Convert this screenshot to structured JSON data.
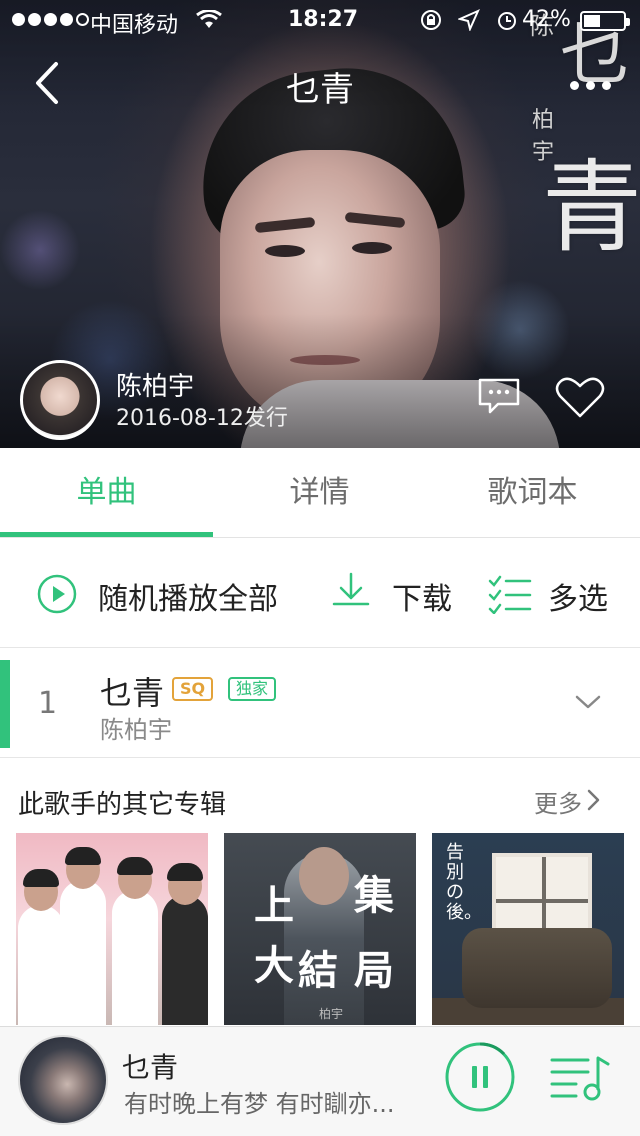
{
  "status_bar": {
    "carrier": "中国移动",
    "time": "18:27",
    "battery_percent": "42%",
    "battery_level": 0.42
  },
  "nav": {
    "title": "乜青"
  },
  "hero": {
    "artist_name": "陈柏宇",
    "release_date": "2016-08-12发行"
  },
  "tabs": [
    {
      "label": "单曲",
      "active": true
    },
    {
      "label": "详情",
      "active": false
    },
    {
      "label": "歌词本",
      "active": false
    }
  ],
  "actions": {
    "play_all": "随机播放全部",
    "download": "下载",
    "multi_select": "多选"
  },
  "tracks": [
    {
      "number": "1",
      "title": "乜青",
      "badges": [
        "SQ",
        "独家"
      ],
      "artist": "陈柏宇"
    }
  ],
  "other_albums": {
    "title": "此歌手的其它专辑",
    "more": "更多",
    "album2_text": [
      "上",
      "集",
      "大",
      "結",
      "局"
    ],
    "album2_sub": "柏宇",
    "album3_title": "告別の後。"
  },
  "player": {
    "title": "乜青",
    "lyric": "有时晚上有梦 有时瞓亦..."
  },
  "colors": {
    "accent": "#31c27c",
    "sq_badge": "#e3a33a"
  },
  "icons": [
    "back-icon",
    "more-dots-icon",
    "comment-icon",
    "heart-icon",
    "play-circle-icon",
    "download-icon",
    "multi-select-icon",
    "chevron-down-icon",
    "chevron-right-icon",
    "pause-icon",
    "playlist-icon",
    "wifi-icon"
  ]
}
